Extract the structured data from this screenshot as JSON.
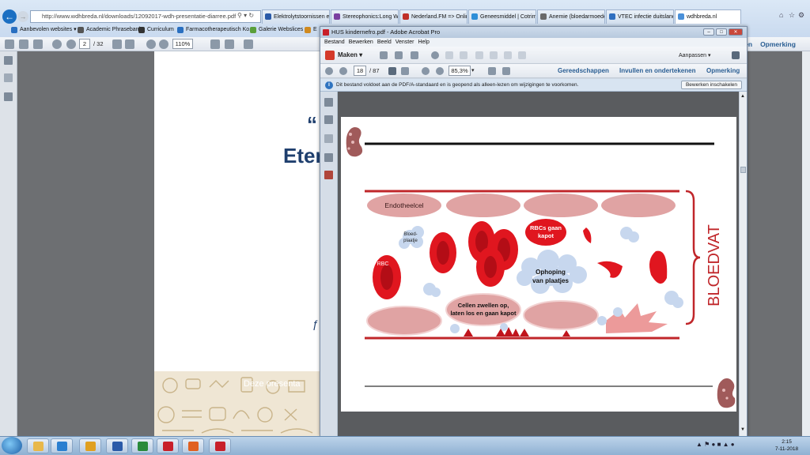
{
  "browser": {
    "address": "http://www.wdhbreda.nl/downloads/12092017-wdh-presentatie-diarree.pdf",
    "tabs": [
      {
        "label": "Elektrolytstoornissen en ...",
        "color": "#2a5aa8"
      },
      {
        "label": "Stereophonics:Long Way...",
        "color": "#7a3fa0"
      },
      {
        "label": "Nederland.FM => Onlin...",
        "color": "#c03028"
      },
      {
        "label": "Geneesmiddel | Cotrimo...",
        "color": "#2f8fd8"
      },
      {
        "label": "Anemie (bloedarmoede)...",
        "color": "#6a6a6a"
      },
      {
        "label": "VTEC infectie duitsland -...",
        "color": "#2f6fc0"
      },
      {
        "label": "wdhbreda.nl",
        "color": "#4a90d9"
      }
    ],
    "favorites": [
      {
        "label": "Aanbevolen websites ▾",
        "color": "#2a6fc0"
      },
      {
        "label": "Academic Phrasebank",
        "color": "#555"
      },
      {
        "label": "Curriculum",
        "color": "#333"
      },
      {
        "label": "Farmacotherapeutisch Ko...",
        "color": "#2a6fc0"
      },
      {
        "label": "Galerie Webslices ▾",
        "color": "#5a9f3a"
      },
      {
        "label": "E",
        "color": "#d08a20"
      }
    ]
  },
  "viewer_bg": {
    "page_current": "2",
    "page_total": "/ 32",
    "zoom": "110%",
    "right_labels": {
      "partial": "nen",
      "comment": "Opmerking"
    },
    "slide_quote": "“",
    "slide_title_partial": "Eter",
    "slide_footer_partial": "Deze presenta"
  },
  "acrobat": {
    "title": "HUS kindernefro.pdf - Adobe Acrobat Pro",
    "menu": [
      "Bestand",
      "Bewerken",
      "Beeld",
      "Venster",
      "Help"
    ],
    "create_label": "Maken ▾",
    "customize_label": "Aanpassen ▾",
    "page_current": "18",
    "page_total": "/ 87",
    "zoom": "85,3%",
    "links": {
      "tools": "Gereedschappen",
      "sign": "Invullen en ondertekenen",
      "comment": "Opmerking"
    },
    "info_text": "Dit bestand voldoet aan de PDF/A-standaard en is geopend als alleen-lezen om wijzigingen te voorkomen.",
    "edit_button": "Bewerken inschakelen"
  },
  "diagram": {
    "endothelial_label": "Endotheelcel",
    "platelet_label": "Bloed-\nplaatje",
    "rbc_label": "RBC",
    "rbc_broken_label": "RBCs gaan\nkapot",
    "platelet_cluster_label": "Ophoping\nvan plaatjes",
    "cells_swell_label": "Cellen zwellen op,\nlaten los en gaan kapot",
    "vessel_label": "BLOEDVAT"
  },
  "taskbar": {
    "time": "2:15",
    "date": "7-11-2018",
    "apps": [
      {
        "name": "explorer",
        "color": "#e8b84a"
      },
      {
        "name": "internet-explorer",
        "color": "#2a7fd0"
      },
      {
        "name": "chrome",
        "color": "#e0a020"
      },
      {
        "name": "word",
        "color": "#2a5aa8"
      },
      {
        "name": "excel",
        "color": "#2a8a3a"
      },
      {
        "name": "epic",
        "color": "#c8202a"
      },
      {
        "name": "media",
        "color": "#e06020"
      },
      {
        "name": "acrobat",
        "color": "#c8202a"
      }
    ]
  }
}
